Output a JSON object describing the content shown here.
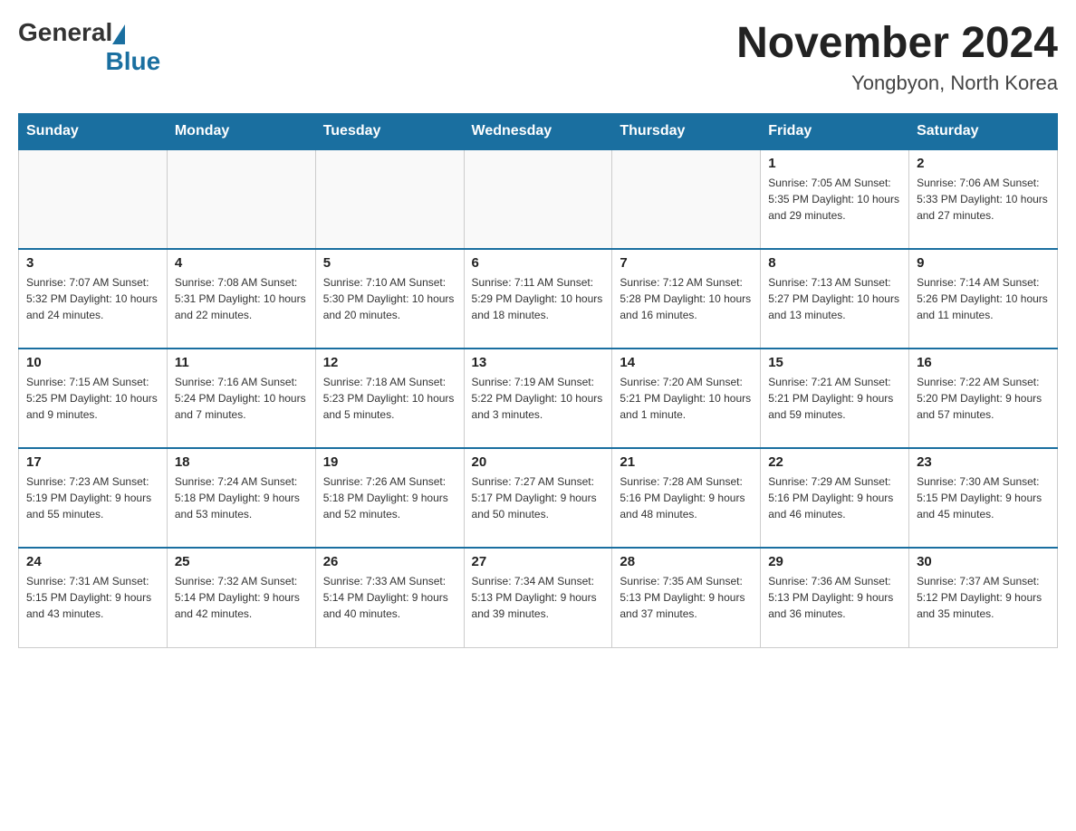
{
  "header": {
    "title": "November 2024",
    "location": "Yongbyon, North Korea",
    "logo_general": "General",
    "logo_blue": "Blue"
  },
  "days_of_week": [
    "Sunday",
    "Monday",
    "Tuesday",
    "Wednesday",
    "Thursday",
    "Friday",
    "Saturday"
  ],
  "weeks": [
    [
      {
        "day": "",
        "info": ""
      },
      {
        "day": "",
        "info": ""
      },
      {
        "day": "",
        "info": ""
      },
      {
        "day": "",
        "info": ""
      },
      {
        "day": "",
        "info": ""
      },
      {
        "day": "1",
        "info": "Sunrise: 7:05 AM\nSunset: 5:35 PM\nDaylight: 10 hours and 29 minutes."
      },
      {
        "day": "2",
        "info": "Sunrise: 7:06 AM\nSunset: 5:33 PM\nDaylight: 10 hours and 27 minutes."
      }
    ],
    [
      {
        "day": "3",
        "info": "Sunrise: 7:07 AM\nSunset: 5:32 PM\nDaylight: 10 hours and 24 minutes."
      },
      {
        "day": "4",
        "info": "Sunrise: 7:08 AM\nSunset: 5:31 PM\nDaylight: 10 hours and 22 minutes."
      },
      {
        "day": "5",
        "info": "Sunrise: 7:10 AM\nSunset: 5:30 PM\nDaylight: 10 hours and 20 minutes."
      },
      {
        "day": "6",
        "info": "Sunrise: 7:11 AM\nSunset: 5:29 PM\nDaylight: 10 hours and 18 minutes."
      },
      {
        "day": "7",
        "info": "Sunrise: 7:12 AM\nSunset: 5:28 PM\nDaylight: 10 hours and 16 minutes."
      },
      {
        "day": "8",
        "info": "Sunrise: 7:13 AM\nSunset: 5:27 PM\nDaylight: 10 hours and 13 minutes."
      },
      {
        "day": "9",
        "info": "Sunrise: 7:14 AM\nSunset: 5:26 PM\nDaylight: 10 hours and 11 minutes."
      }
    ],
    [
      {
        "day": "10",
        "info": "Sunrise: 7:15 AM\nSunset: 5:25 PM\nDaylight: 10 hours and 9 minutes."
      },
      {
        "day": "11",
        "info": "Sunrise: 7:16 AM\nSunset: 5:24 PM\nDaylight: 10 hours and 7 minutes."
      },
      {
        "day": "12",
        "info": "Sunrise: 7:18 AM\nSunset: 5:23 PM\nDaylight: 10 hours and 5 minutes."
      },
      {
        "day": "13",
        "info": "Sunrise: 7:19 AM\nSunset: 5:22 PM\nDaylight: 10 hours and 3 minutes."
      },
      {
        "day": "14",
        "info": "Sunrise: 7:20 AM\nSunset: 5:21 PM\nDaylight: 10 hours and 1 minute."
      },
      {
        "day": "15",
        "info": "Sunrise: 7:21 AM\nSunset: 5:21 PM\nDaylight: 9 hours and 59 minutes."
      },
      {
        "day": "16",
        "info": "Sunrise: 7:22 AM\nSunset: 5:20 PM\nDaylight: 9 hours and 57 minutes."
      }
    ],
    [
      {
        "day": "17",
        "info": "Sunrise: 7:23 AM\nSunset: 5:19 PM\nDaylight: 9 hours and 55 minutes."
      },
      {
        "day": "18",
        "info": "Sunrise: 7:24 AM\nSunset: 5:18 PM\nDaylight: 9 hours and 53 minutes."
      },
      {
        "day": "19",
        "info": "Sunrise: 7:26 AM\nSunset: 5:18 PM\nDaylight: 9 hours and 52 minutes."
      },
      {
        "day": "20",
        "info": "Sunrise: 7:27 AM\nSunset: 5:17 PM\nDaylight: 9 hours and 50 minutes."
      },
      {
        "day": "21",
        "info": "Sunrise: 7:28 AM\nSunset: 5:16 PM\nDaylight: 9 hours and 48 minutes."
      },
      {
        "day": "22",
        "info": "Sunrise: 7:29 AM\nSunset: 5:16 PM\nDaylight: 9 hours and 46 minutes."
      },
      {
        "day": "23",
        "info": "Sunrise: 7:30 AM\nSunset: 5:15 PM\nDaylight: 9 hours and 45 minutes."
      }
    ],
    [
      {
        "day": "24",
        "info": "Sunrise: 7:31 AM\nSunset: 5:15 PM\nDaylight: 9 hours and 43 minutes."
      },
      {
        "day": "25",
        "info": "Sunrise: 7:32 AM\nSunset: 5:14 PM\nDaylight: 9 hours and 42 minutes."
      },
      {
        "day": "26",
        "info": "Sunrise: 7:33 AM\nSunset: 5:14 PM\nDaylight: 9 hours and 40 minutes."
      },
      {
        "day": "27",
        "info": "Sunrise: 7:34 AM\nSunset: 5:13 PM\nDaylight: 9 hours and 39 minutes."
      },
      {
        "day": "28",
        "info": "Sunrise: 7:35 AM\nSunset: 5:13 PM\nDaylight: 9 hours and 37 minutes."
      },
      {
        "day": "29",
        "info": "Sunrise: 7:36 AM\nSunset: 5:13 PM\nDaylight: 9 hours and 36 minutes."
      },
      {
        "day": "30",
        "info": "Sunrise: 7:37 AM\nSunset: 5:12 PM\nDaylight: 9 hours and 35 minutes."
      }
    ]
  ]
}
